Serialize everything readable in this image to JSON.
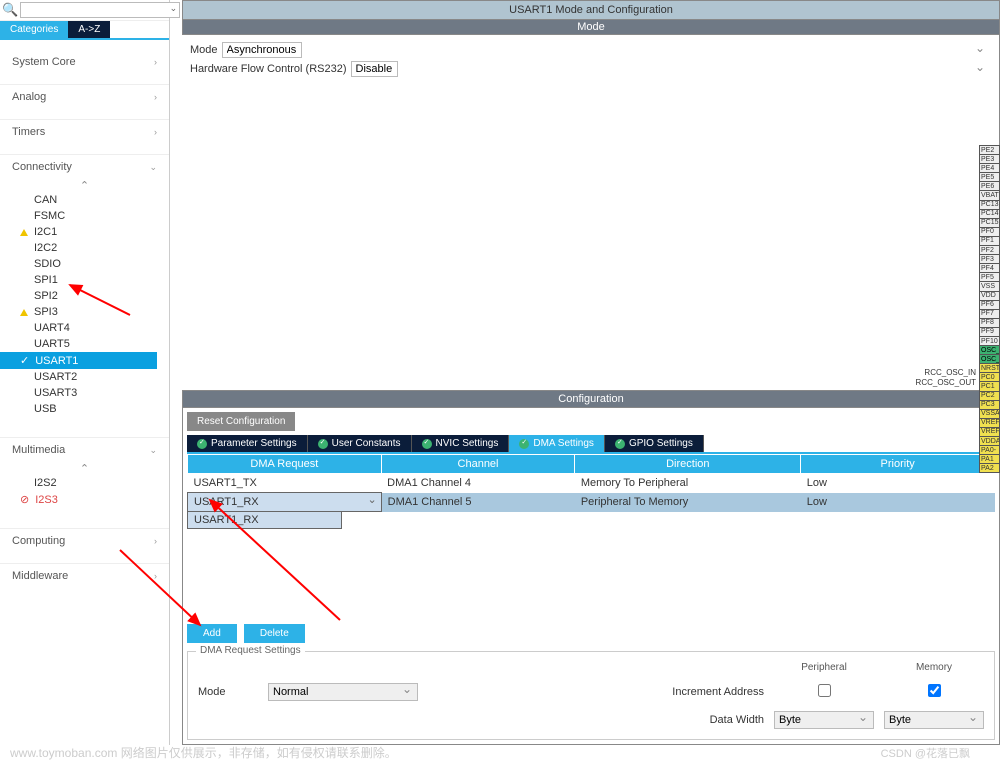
{
  "sidebar": {
    "tabs": {
      "cat": "Categories",
      "az": "A->Z"
    },
    "cats": {
      "system": "System Core",
      "analog": "Analog",
      "timers": "Timers",
      "conn": "Connectivity",
      "mm": "Multimedia",
      "comp": "Computing",
      "mw": "Middleware"
    },
    "conn_items": [
      "CAN",
      "FSMC",
      "I2C1",
      "I2C2",
      "SDIO",
      "SPI1",
      "SPI2",
      "SPI3",
      "UART4",
      "UART5",
      "USART1",
      "USART2",
      "USART3",
      "USB"
    ],
    "mm_items": {
      "i2s2": "I2S2",
      "i2s3": "I2S3"
    }
  },
  "header": {
    "title": "USART1 Mode and Configuration",
    "mode_hdr": "Mode",
    "mode_lbl": "Mode",
    "mode_val": "Asynchronous",
    "hw_lbl": "Hardware Flow Control (RS232)",
    "hw_val": "Disable",
    "cfg_hdr": "Configuration",
    "reset": "Reset Configuration"
  },
  "cfg_tabs": {
    "param": "Parameter Settings",
    "user": "User Constants",
    "nvic": "NVIC Settings",
    "dma": "DMA Settings",
    "gpio": "GPIO Settings"
  },
  "dma": {
    "cols": {
      "req": "DMA Request",
      "ch": "Channel",
      "dir": "Direction",
      "pri": "Priority"
    },
    "rows": [
      {
        "req": "USART1_TX",
        "ch": "DMA1 Channel 4",
        "dir": "Memory To Peripheral",
        "pri": "Low"
      },
      {
        "req": "USART1_RX",
        "ch": "DMA1 Channel 5",
        "dir": "Peripheral To Memory",
        "pri": "Low"
      }
    ],
    "dd": "USART1_RX",
    "add": "Add",
    "del": "Delete"
  },
  "req": {
    "legend": "DMA Request Settings",
    "periph": "Peripheral",
    "mem": "Memory",
    "mode_lbl": "Mode",
    "mode_val": "Normal",
    "inc": "Increment Address",
    "dw": "Data Width",
    "dw_p": "Byte",
    "dw_m": "Byte"
  },
  "pins": [
    "PE2",
    "PE3",
    "PE4",
    "PE5",
    "PE6",
    "VBAT",
    "PC13",
    "PC14",
    "PC15",
    "PF0",
    "PF1",
    "PF2",
    "PF3",
    "PF4",
    "PF5",
    "VSS",
    "VDD",
    "PF6",
    "PF7",
    "PF8",
    "PF9",
    "PF10",
    "OSC_",
    "OSC_",
    "NRST",
    "PC0",
    "PC1",
    "PC2",
    "PC3",
    "VSSA",
    "VREF-",
    "VREF_",
    "VDDA",
    "PA0-",
    "PA1",
    "PA2"
  ],
  "pin_labels": {
    "osc_in": "RCC_OSC_IN",
    "osc_out": "RCC_OSC_OUT"
  },
  "wm1": "www.toymoban.com 网络图片仅供展示，非存储，如有侵权请联系删除。",
  "wm2": "CSDN @花落已飘"
}
